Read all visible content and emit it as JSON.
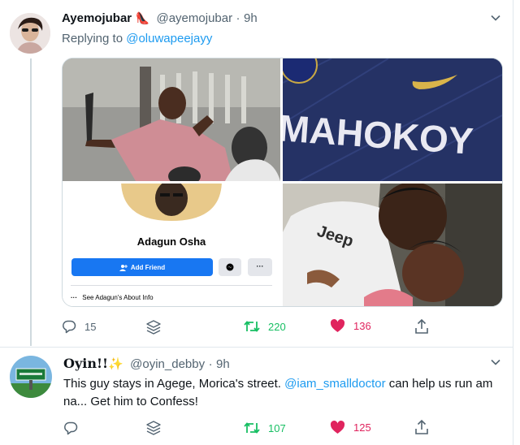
{
  "tweet1": {
    "display_name": "Ayemojubar",
    "name_emoji": "👠",
    "handle": "@ayemojubar",
    "dot": "·",
    "time": "9h",
    "replying_prefix": "Replying to",
    "replying_to": "@oluwapeejayy",
    "fb_card": {
      "name": "Adagun Osha",
      "add_friend": "Add Friend",
      "more": "···",
      "about": "See Adagun's About Info",
      "about_dots": "···"
    },
    "photo_text": "MAHOKOY",
    "shirt_text": "Jeep",
    "reply_count": "15",
    "retweet_count": "220",
    "like_count": "136"
  },
  "tweet2": {
    "display_name": "Oyin!!",
    "name_emoji": "✨",
    "handle": "@oyin_debby",
    "dot": "·",
    "time": "9h",
    "text_before": "This guy stays in Agege, Morica's street.",
    "mention": "@iam_smalldoctor",
    "text_after": "can help us run am na... Get him to Confess!",
    "reply_count": "",
    "retweet_count": "107",
    "like_count": "125"
  },
  "colors": {
    "accent": "#1d9bf0",
    "retweet": "#17bf63",
    "like": "#e0245e",
    "muted": "#536471",
    "fb_blue": "#1877f2"
  },
  "icons": [
    "chevron-down-icon",
    "reply-icon",
    "retweet-icon",
    "heart-icon",
    "share-icon",
    "stack-icon",
    "messenger-icon",
    "add-friend-icon"
  ]
}
